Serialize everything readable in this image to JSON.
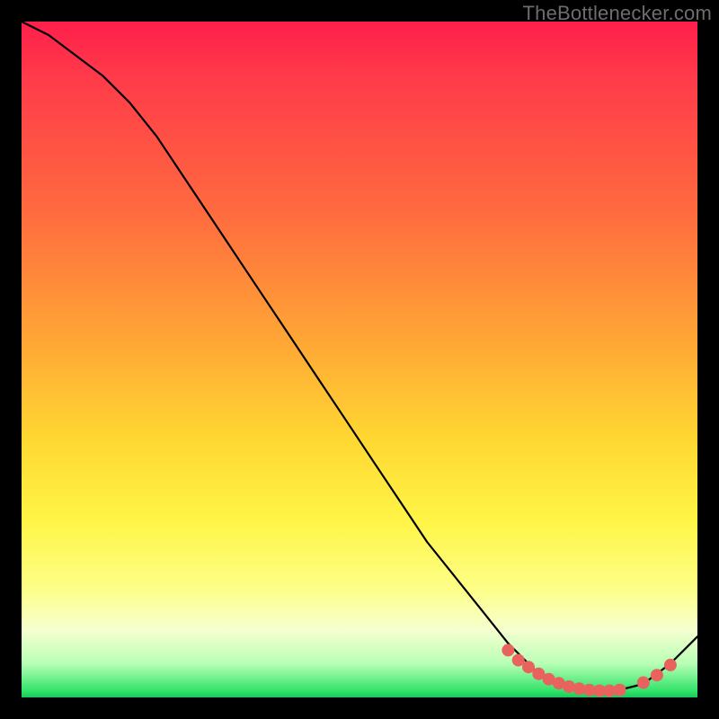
{
  "watermark": "TheBottlenecker.com",
  "colors": {
    "frame": "#000000",
    "dot": "#e9635e",
    "line": "#000000",
    "gradient_stops": [
      "#ff1f4b",
      "#ff6a3f",
      "#ffd832",
      "#fdff88",
      "#34e36b"
    ]
  },
  "chart_data": {
    "type": "line",
    "title": "",
    "xlabel": "",
    "ylabel": "",
    "xlim": [
      0,
      100
    ],
    "ylim": [
      0,
      100
    ],
    "grid": false,
    "legend": false,
    "series": [
      {
        "name": "curve",
        "x": [
          0,
          4,
          8,
          12,
          16,
          20,
          24,
          28,
          32,
          36,
          40,
          44,
          48,
          52,
          56,
          60,
          64,
          68,
          72,
          76,
          80,
          84,
          88,
          92,
          96,
          100
        ],
        "y": [
          100,
          98,
          95,
          92,
          88,
          83,
          77,
          71,
          65,
          59,
          53,
          47,
          41,
          35,
          29,
          23,
          18,
          13,
          8,
          4,
          2,
          1,
          1,
          2,
          5,
          9
        ]
      }
    ],
    "markers": {
      "name": "highlight-dots",
      "x": [
        72,
        73.5,
        75,
        76.5,
        78,
        79.5,
        81,
        82.5,
        84,
        85.5,
        87,
        88.5,
        92,
        94,
        96
      ],
      "y": [
        7,
        5.5,
        4.5,
        3.5,
        2.7,
        2.1,
        1.6,
        1.3,
        1.1,
        1.0,
        1.0,
        1.1,
        2.2,
        3.3,
        4.8
      ]
    }
  }
}
